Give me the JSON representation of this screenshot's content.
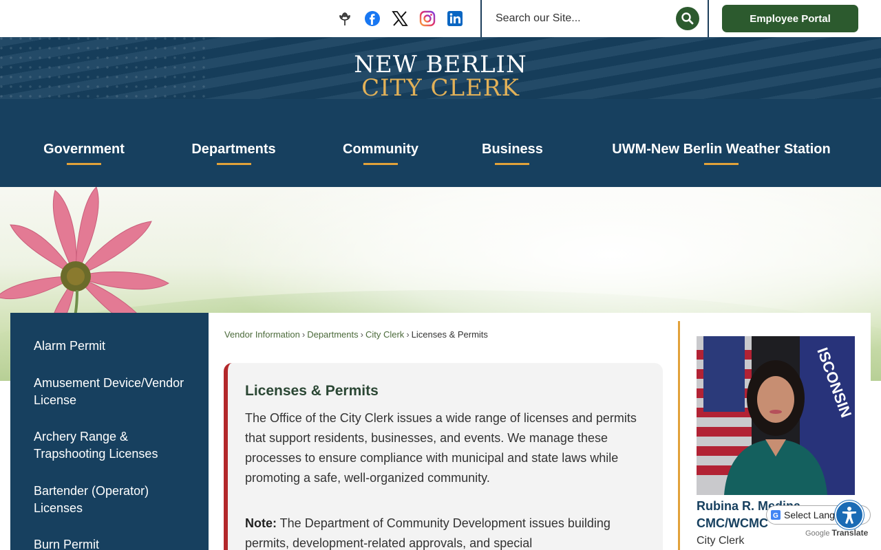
{
  "topbar": {
    "social": [
      {
        "name": "city-tree-icon"
      },
      {
        "name": "facebook-icon"
      },
      {
        "name": "x-icon"
      },
      {
        "name": "instagram-icon"
      },
      {
        "name": "linkedin-icon"
      }
    ],
    "search": {
      "placeholder": "Search our Site..."
    },
    "employee_portal_label": "Employee Portal"
  },
  "header": {
    "logo_line1": "NEW BERLIN",
    "logo_line2": "CITY CLERK",
    "nav": [
      {
        "label": "Government"
      },
      {
        "label": "Departments"
      },
      {
        "label": "Community"
      },
      {
        "label": "Business"
      },
      {
        "label": "UWM-New Berlin Weather Station"
      }
    ]
  },
  "sidebar": {
    "items": [
      {
        "label": "Alarm Permit"
      },
      {
        "label": "Amusement Device/Vendor License"
      },
      {
        "label": "Archery Range & Trapshooting Licenses"
      },
      {
        "label": "Bartender (Operator) Licenses"
      },
      {
        "label": "Burn Permit"
      }
    ]
  },
  "breadcrumb": {
    "items": [
      "Vendor Information",
      "Departments",
      "City Clerk"
    ],
    "current": "Licenses & Permits",
    "separator": "›"
  },
  "content": {
    "title": "Licenses & Permits",
    "body": "The Office of the City Clerk issues a wide range of licenses and permits that support residents, businesses, and events. We manage these processes to ensure compliance with municipal and state laws while promoting a safe, well-organized community.",
    "note_label": "Note:",
    "note_text": " The Department of Community Development issues building permits, development-related approvals, and special"
  },
  "contact": {
    "name": "Rubina R. Medina, CMC/WCMC",
    "title": "City Clerk"
  },
  "translate": {
    "select_label": "Select Langu",
    "powered_by": "Google",
    "translate_word": "Translate"
  },
  "colors": {
    "navy": "#17405f",
    "green": "#2c5a2e",
    "gold": "#e2a23a",
    "red": "#b3282b"
  }
}
